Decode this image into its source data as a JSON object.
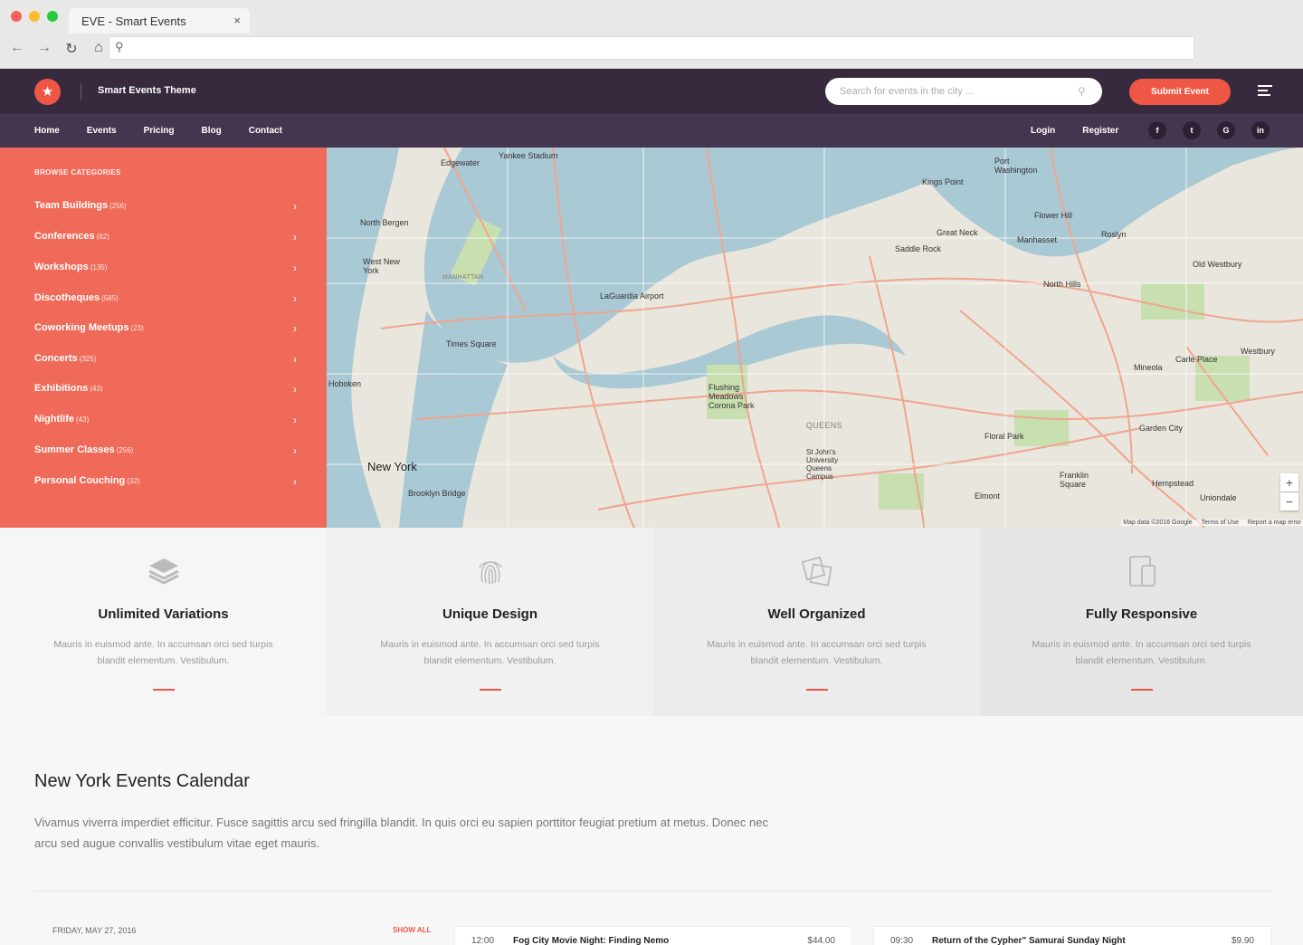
{
  "browser": {
    "tab_title": "EVE - Smart Events",
    "tab_close": "×"
  },
  "header": {
    "brand": "Smart Events Theme",
    "search_placeholder": "Search for events in the city ...",
    "submit_label": "Submit Event"
  },
  "nav": {
    "items": [
      "Home",
      "Events",
      "Pricing",
      "Blog",
      "Contact"
    ],
    "login": "Login",
    "register": "Register",
    "socials": [
      "f",
      "t",
      "G",
      "in"
    ]
  },
  "sidebar": {
    "heading": "BROWSE CATEGORIES",
    "categories": [
      {
        "name": "Team Buildings",
        "count": "(256)"
      },
      {
        "name": "Conferences",
        "count": "(82)"
      },
      {
        "name": "Workshops",
        "count": "(135)"
      },
      {
        "name": "Discotheques",
        "count": "(585)"
      },
      {
        "name": "Coworking Meetups",
        "count": "(23)"
      },
      {
        "name": "Concerts",
        "count": "(325)"
      },
      {
        "name": "Exhibitions",
        "count": "(43)"
      },
      {
        "name": "Nightlife",
        "count": "(43)"
      },
      {
        "name": "Summer Classes",
        "count": "(256)"
      },
      {
        "name": "Personal Couching",
        "count": "(32)"
      }
    ]
  },
  "map": {
    "labels": {
      "new_york": "New York",
      "queens": "QUEENS",
      "manhattan": "MANHATTAN",
      "laguardia": "LaGuardia Airport",
      "times_square": "Times Square",
      "hoboken": "Hoboken",
      "north_bergen": "North Bergen",
      "west_new_york": "West New York",
      "edgewater": "Edgewater",
      "yankee_stadium": "Yankee Stadium",
      "kings_point": "Kings Point",
      "port_washington": "Port Washington",
      "great_neck": "Great Neck",
      "manhasset": "Manhasset",
      "roslyn": "Roslyn",
      "flushing_meadows": "Flushing Meadows Corona Park",
      "floral_park": "Floral Park",
      "garden_city": "Garden City",
      "mineola": "Mineola",
      "hempstead": "Hempstead",
      "elmont": "Elmont",
      "uniondale": "Uniondale",
      "brooklyn_bridge": "Brooklyn Bridge",
      "saddle_rock": "Saddle Rock",
      "north_hills": "North Hills",
      "westbury": "Westbury",
      "carle_place": "Carle Place",
      "old_westbury": "Old Westbury",
      "flower_hill": "Flower Hill",
      "franklin_square": "Franklin Square",
      "st_johns": "St John's University Queens Campus"
    },
    "attribution": "Map data ©2016 Google",
    "terms": "Terms of Use",
    "report": "Report a map error",
    "zoom_in": "+",
    "zoom_out": "−"
  },
  "features": [
    {
      "title": "Unlimited Variations",
      "text": "Mauris in euismod ante. In accumsan orci sed turpis blandit elementum. Vestibulum.",
      "icon": "layers-icon"
    },
    {
      "title": "Unique Design",
      "text": "Mauris in euismod ante. In accumsan orci sed turpis blandit elementum. Vestibulum.",
      "icon": "fingerprint-icon"
    },
    {
      "title": "Well Organized",
      "text": "Mauris in euismod ante. In accumsan orci sed turpis blandit elementum. Vestibulum.",
      "icon": "squares-icon"
    },
    {
      "title": "Fully Responsive",
      "text": "Mauris in euismod ante. In accumsan orci sed turpis blandit elementum. Vestibulum.",
      "icon": "devices-icon"
    }
  ],
  "calendar": {
    "title": "New York Events Calendar",
    "intro": "Vivamus viverra imperdiet efficitur. Fusce sagittis arcu sed fringilla blandit. In quis orci eu sapien porttitor feugiat pretium at metus. Donec nec arcu sed augue convallis vestibulum vitae eget mauris.",
    "date": "FRIDAY, MAY 27, 2016",
    "show_all": "SHOW ALL",
    "events": [
      {
        "time": "12:00",
        "name": "Fog City Movie Night: Finding Nemo",
        "price": "$44.00"
      },
      {
        "time": "09:30",
        "name": "Return of the Cypher\" Samurai Sunday Night",
        "price": "$9.90"
      }
    ]
  },
  "colors": {
    "accent": "#ef5744",
    "header_bg": "#372a3e",
    "nav_bg": "#453650",
    "sidebar_bg": "#ef6a58"
  }
}
